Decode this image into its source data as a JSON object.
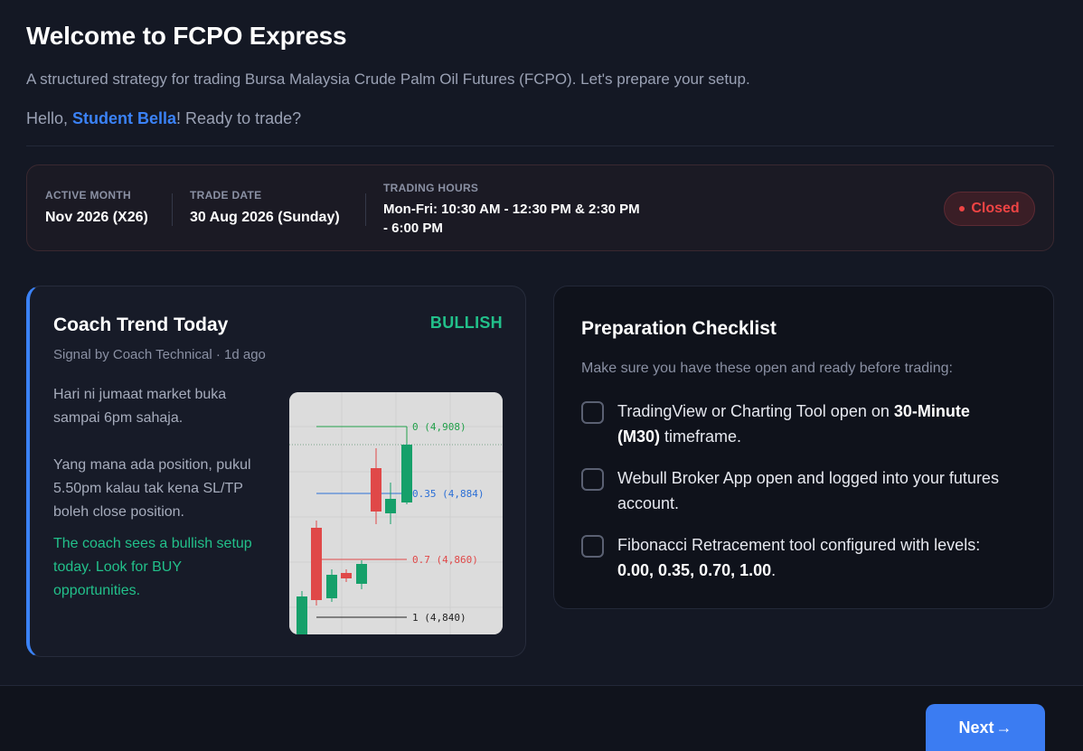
{
  "header": {
    "title": "Welcome to FCPO Express",
    "subtitle": "A structured strategy for trading Bursa Malaysia Crude Palm Oil Futures (FCPO). Let's prepare your setup.",
    "greeting_prefix": "Hello, ",
    "user_name": "Student Bella",
    "greeting_suffix": "! Ready to trade?"
  },
  "session": {
    "active_month_label": "ACTIVE MONTH",
    "active_month_value": "Nov 2026 (X26)",
    "trade_date_label": "TRADE DATE",
    "trade_date_value": "30 Aug 2026 (Sunday)",
    "trading_hours_label": "TRADING HOURS",
    "trading_hours_value": "Mon-Fri: 10:30 AM - 12:30 PM & 2:30 PM - 6:00 PM",
    "market_status": "Closed",
    "status_color": "#ef4444"
  },
  "coach": {
    "title": "Coach Trend Today",
    "trend": "BULLISH",
    "trend_color": "#22c08a",
    "meta": "Signal by Coach Technical · 1d ago",
    "message_1": "Hari ni jumaat market buka sampai 6pm sahaja.",
    "message_2": "Yang mana ada position, pukul 5.50pm kalau tak kena SL/TP boleh close position.",
    "outlook": "The coach sees a bullish setup today. Look for BUY opportunities.",
    "fib_levels": [
      {
        "label": "0 (4,908)",
        "level": 0,
        "price": 4908,
        "color": "#22a04a"
      },
      {
        "label": "0.35 (4,884)",
        "level": 0.35,
        "price": 4884,
        "color": "#2b6fd6"
      },
      {
        "label": "0.7 (4,860)",
        "level": 0.7,
        "price": 4860,
        "color": "#e04848"
      },
      {
        "label": "1 (4,840)",
        "level": 1,
        "price": 4840,
        "color": "#222222"
      }
    ]
  },
  "checklist": {
    "title": "Preparation Checklist",
    "intro": "Make sure you have these open and ready before trading:",
    "item1_a": "TradingView or Charting Tool open on ",
    "item1_b": "30-Minute (M30)",
    "item1_c": " timeframe.",
    "item2": "Webull Broker App open and logged into your futures account.",
    "item3_a": "Fibonacci Retracement tool configured with levels: ",
    "item3_b": "0.00, 0.35, 0.70, 1.00",
    "item3_c": "."
  },
  "footer": {
    "next_label": "Next",
    "next_arrow": "→"
  }
}
